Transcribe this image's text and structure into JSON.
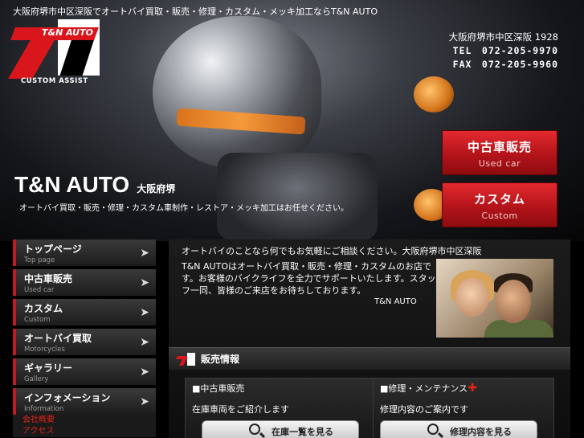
{
  "header": {
    "top_text": "大阪府堺市中区深阪でオートバイ買取・販売・修理・カスタム・メッキ加工ならT&N AUTO",
    "logo": {
      "banner": "T&N AUTO",
      "subtitle": "CUSTOM ASSIST"
    },
    "address": "大阪府堺市中区深阪 1928",
    "tel": "TEL　072-205-9970",
    "fax": "FAX　072-205-9960"
  },
  "hero": {
    "brand": "T&N AUTO",
    "location": "大阪府堺",
    "tagline": "オートバイ買取・販売・修理・カスタム車制作・レストア・メッキ加工はお任せください。",
    "buttons": [
      {
        "jp": "中古車販売",
        "en": "Used car"
      },
      {
        "jp": "カスタム",
        "en": "Custom"
      }
    ]
  },
  "sidebar": {
    "items": [
      {
        "jp": "トップページ",
        "en": "Top page"
      },
      {
        "jp": "中古車販売",
        "en": "Used car"
      },
      {
        "jp": "カスタム",
        "en": "Custom"
      },
      {
        "jp": "オートバイ買取",
        "en": "Motorcycles"
      },
      {
        "jp": "ギャラリー",
        "en": "Gallery"
      },
      {
        "jp": "インフォメーション",
        "en": "Information"
      }
    ],
    "sub_links": [
      "会社概要",
      "アクセス"
    ]
  },
  "main": {
    "intro_title": "オートバイのことなら何でもお気軽にご相談ください。大阪府堺市中区深阪",
    "intro_body": "T&N AUTOはオートバイ買取・販売・修理・カスタムのお店です。お客様のバイクライフを全力でサポートいたします。スタッフ一同、皆様のご来店をお待ちしております。",
    "intro_sign": "T&N AUTO",
    "section_title": "販売情報",
    "cards": [
      {
        "title": "■中古車販売",
        "desc": "在庫車両をご紹介します",
        "button": "在庫一覧を見る",
        "has_cross": false
      },
      {
        "title": "■修理・メンテナンス",
        "desc": "修理内容のご案内です",
        "button": "修理内容を見る",
        "has_cross": true
      }
    ]
  },
  "colors": {
    "accent": "#d9161c",
    "background": "#000000"
  }
}
